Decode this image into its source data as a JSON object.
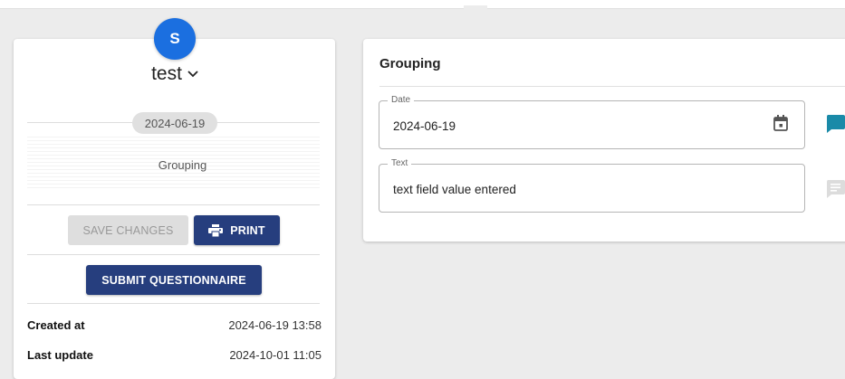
{
  "left_card": {
    "avatar_letter": "S",
    "title": "test",
    "date_chip": "2024-06-19",
    "group_label": "Grouping",
    "save_label": "SAVE CHANGES",
    "print_label": "PRINT",
    "submit_label": "SUBMIT QUESTIONNAIRE",
    "meta": [
      {
        "label": "Created at",
        "value": "2024-06-19 13:58"
      },
      {
        "label": "Last update",
        "value": "2024-10-01 11:05"
      }
    ]
  },
  "right_card": {
    "title": "Grouping",
    "fields": [
      {
        "legend": "Date",
        "value": "2024-06-19"
      },
      {
        "legend": "Text",
        "value": "text field value entered"
      }
    ]
  },
  "colors": {
    "accent": "#263e7e",
    "avatar": "#1b6fe0",
    "comment_active": "#1a8aa8",
    "comment_inactive": "#dcdcdc"
  },
  "icons": {
    "chevron": "chevron-down-icon",
    "print": "printer-icon",
    "calendar": "calendar-icon",
    "comment": "comment-icon"
  }
}
